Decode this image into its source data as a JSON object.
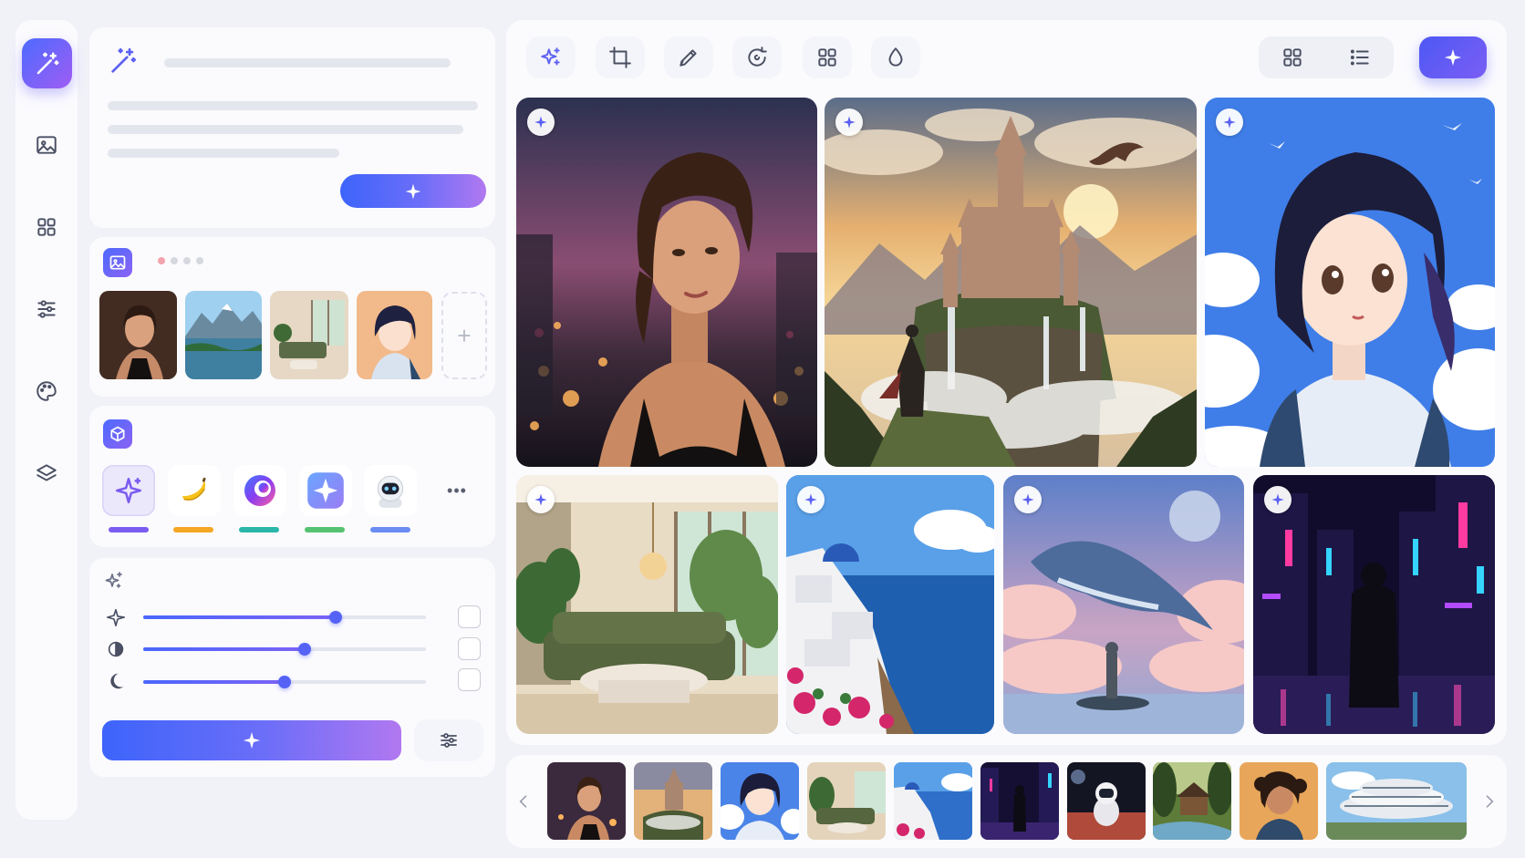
{
  "theme": {
    "accent": "#5c61f2",
    "gradient_start": "#3d64fb",
    "gradient_end": "#b178f0"
  },
  "sidebar": {
    "logo_icon": "magic-wand-icon",
    "items": [
      {
        "icon": "image-icon"
      },
      {
        "icon": "grid-icon"
      },
      {
        "icon": "sliders-icon"
      },
      {
        "icon": "palette-icon"
      },
      {
        "icon": "layers-icon"
      }
    ]
  },
  "prompt": {
    "icon": "magic-wand-icon",
    "generate_icon": "sparkle-icon"
  },
  "reference": {
    "icon": "image-icon",
    "pager": {
      "count": 4,
      "active": 0
    },
    "thumbs": [
      "portrait-woman",
      "mountain-lake",
      "living-room",
      "anime-girl"
    ],
    "add_label": "+"
  },
  "models": {
    "icon": "cube-icon",
    "items": [
      {
        "icon": "sparkle-icon",
        "bar_color": "#7b5cf0",
        "selected": true
      },
      {
        "icon": "banana-icon",
        "bar_color": "#f5a623",
        "selected": false
      },
      {
        "icon": "swirl-logo-icon",
        "bar_color": "#2bb6a9",
        "selected": false
      },
      {
        "icon": "star-tile-icon",
        "bar_color": "#56c271",
        "selected": false
      },
      {
        "icon": "robot-icon",
        "bar_color": "#6b8cf2",
        "selected": false
      }
    ],
    "more_label": "•••"
  },
  "adjustments": {
    "header_icon": "sparkles-icon",
    "sliders": [
      {
        "icon": "sparkle-icon",
        "value": 0.68,
        "checked": false
      },
      {
        "icon": "contrast-icon",
        "value": 0.57,
        "checked": false
      },
      {
        "icon": "moon-icon",
        "value": 0.5,
        "checked": false
      }
    ]
  },
  "toolbar": {
    "tools": [
      "magic-icon",
      "crop-icon",
      "pen-icon",
      "refresh-icon",
      "grid-icon",
      "drop-icon"
    ],
    "active_tool": 0,
    "view_modes": [
      "grid-icon",
      "list-icon"
    ],
    "active_view": 0,
    "cta_icon": "sparkle-icon"
  },
  "gallery": {
    "images": [
      "woman-city-night-portrait",
      "fantasy-castle-waterfall",
      "anime-girl-sky",
      "luxury-living-room",
      "santorini-coast",
      "sky-whale",
      "cyberpunk-street"
    ]
  },
  "filmstrip": {
    "prev_icon": "chevron-left-icon",
    "next_icon": "chevron-right-icon",
    "thumbs": [
      "woman-portrait",
      "castle",
      "anime-girl",
      "living-room",
      "santorini",
      "cyberpunk",
      "astronaut",
      "forest-cabin",
      "curly-woman",
      "modern-building"
    ]
  }
}
